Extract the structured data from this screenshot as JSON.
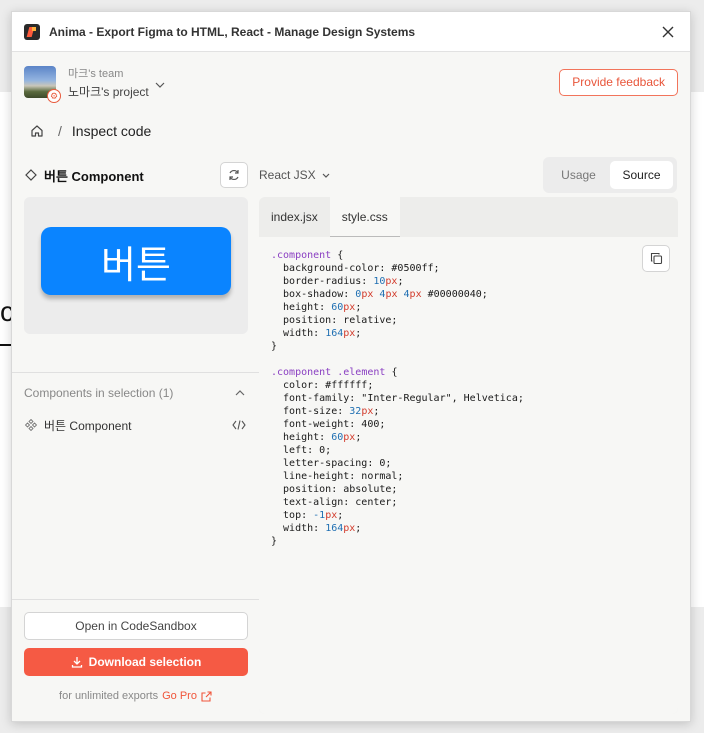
{
  "window": {
    "title": "Anima - Export Figma to HTML, React - Manage Design Systems"
  },
  "header": {
    "team_name": "마크's team",
    "project_name": "노마크's project",
    "feedback_label": "Provide feedback"
  },
  "breadcrumb": {
    "separator": "/",
    "current": "Inspect code"
  },
  "component": {
    "title": "버튼 Component",
    "preview_text": "버튼"
  },
  "selection": {
    "label": "Components in selection (1)",
    "items": [
      {
        "label": "버튼 Component"
      }
    ]
  },
  "footer": {
    "sandbox_label": "Open in CodeSandbox",
    "download_label": "Download selection",
    "pro_text": "for unlimited exports",
    "pro_link": "Go Pro"
  },
  "code": {
    "language": "React JSX",
    "view_options": [
      "Usage",
      "Source"
    ],
    "active_view": "Source",
    "tabs": [
      "index.jsx",
      "style.css"
    ],
    "active_tab": "style.css",
    "css_lines": [
      ".component {",
      "  background-color: #0500ff;",
      "  border-radius: 10px;",
      "  box-shadow: 0px 4px 4px #00000040;",
      "  height: 60px;",
      "  position: relative;",
      "  width: 164px;",
      "}",
      "",
      ".component .element {",
      "  color: #ffffff;",
      "  font-family: \"Inter-Regular\", Helvetica;",
      "  font-size: 32px;",
      "  font-weight: 400;",
      "  height: 60px;",
      "  left: 0;",
      "  letter-spacing: 0;",
      "  line-height: normal;",
      "  position: absolute;",
      "  text-align: center;",
      "  top: -1px;",
      "  width: 164px;",
      "}"
    ]
  },
  "colors": {
    "accent": "#f55a44",
    "preview_button": "#0a84ff"
  }
}
